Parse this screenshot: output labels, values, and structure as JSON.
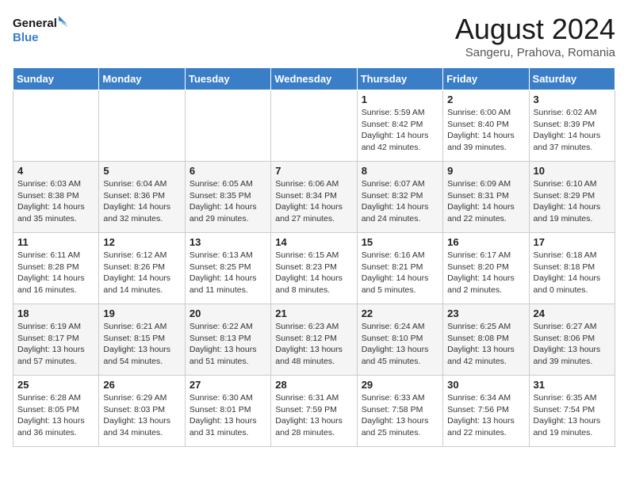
{
  "header": {
    "logo_line1": "General",
    "logo_line2": "Blue",
    "month_year": "August 2024",
    "location": "Sangeru, Prahova, Romania"
  },
  "weekdays": [
    "Sunday",
    "Monday",
    "Tuesday",
    "Wednesday",
    "Thursday",
    "Friday",
    "Saturday"
  ],
  "weeks": [
    [
      {
        "day": "",
        "info": ""
      },
      {
        "day": "",
        "info": ""
      },
      {
        "day": "",
        "info": ""
      },
      {
        "day": "",
        "info": ""
      },
      {
        "day": "1",
        "info": "Sunrise: 5:59 AM\nSunset: 8:42 PM\nDaylight: 14 hours\nand 42 minutes."
      },
      {
        "day": "2",
        "info": "Sunrise: 6:00 AM\nSunset: 8:40 PM\nDaylight: 14 hours\nand 39 minutes."
      },
      {
        "day": "3",
        "info": "Sunrise: 6:02 AM\nSunset: 8:39 PM\nDaylight: 14 hours\nand 37 minutes."
      }
    ],
    [
      {
        "day": "4",
        "info": "Sunrise: 6:03 AM\nSunset: 8:38 PM\nDaylight: 14 hours\nand 35 minutes."
      },
      {
        "day": "5",
        "info": "Sunrise: 6:04 AM\nSunset: 8:36 PM\nDaylight: 14 hours\nand 32 minutes."
      },
      {
        "day": "6",
        "info": "Sunrise: 6:05 AM\nSunset: 8:35 PM\nDaylight: 14 hours\nand 29 minutes."
      },
      {
        "day": "7",
        "info": "Sunrise: 6:06 AM\nSunset: 8:34 PM\nDaylight: 14 hours\nand 27 minutes."
      },
      {
        "day": "8",
        "info": "Sunrise: 6:07 AM\nSunset: 8:32 PM\nDaylight: 14 hours\nand 24 minutes."
      },
      {
        "day": "9",
        "info": "Sunrise: 6:09 AM\nSunset: 8:31 PM\nDaylight: 14 hours\nand 22 minutes."
      },
      {
        "day": "10",
        "info": "Sunrise: 6:10 AM\nSunset: 8:29 PM\nDaylight: 14 hours\nand 19 minutes."
      }
    ],
    [
      {
        "day": "11",
        "info": "Sunrise: 6:11 AM\nSunset: 8:28 PM\nDaylight: 14 hours\nand 16 minutes."
      },
      {
        "day": "12",
        "info": "Sunrise: 6:12 AM\nSunset: 8:26 PM\nDaylight: 14 hours\nand 14 minutes."
      },
      {
        "day": "13",
        "info": "Sunrise: 6:13 AM\nSunset: 8:25 PM\nDaylight: 14 hours\nand 11 minutes."
      },
      {
        "day": "14",
        "info": "Sunrise: 6:15 AM\nSunset: 8:23 PM\nDaylight: 14 hours\nand 8 minutes."
      },
      {
        "day": "15",
        "info": "Sunrise: 6:16 AM\nSunset: 8:21 PM\nDaylight: 14 hours\nand 5 minutes."
      },
      {
        "day": "16",
        "info": "Sunrise: 6:17 AM\nSunset: 8:20 PM\nDaylight: 14 hours\nand 2 minutes."
      },
      {
        "day": "17",
        "info": "Sunrise: 6:18 AM\nSunset: 8:18 PM\nDaylight: 14 hours\nand 0 minutes."
      }
    ],
    [
      {
        "day": "18",
        "info": "Sunrise: 6:19 AM\nSunset: 8:17 PM\nDaylight: 13 hours\nand 57 minutes."
      },
      {
        "day": "19",
        "info": "Sunrise: 6:21 AM\nSunset: 8:15 PM\nDaylight: 13 hours\nand 54 minutes."
      },
      {
        "day": "20",
        "info": "Sunrise: 6:22 AM\nSunset: 8:13 PM\nDaylight: 13 hours\nand 51 minutes."
      },
      {
        "day": "21",
        "info": "Sunrise: 6:23 AM\nSunset: 8:12 PM\nDaylight: 13 hours\nand 48 minutes."
      },
      {
        "day": "22",
        "info": "Sunrise: 6:24 AM\nSunset: 8:10 PM\nDaylight: 13 hours\nand 45 minutes."
      },
      {
        "day": "23",
        "info": "Sunrise: 6:25 AM\nSunset: 8:08 PM\nDaylight: 13 hours\nand 42 minutes."
      },
      {
        "day": "24",
        "info": "Sunrise: 6:27 AM\nSunset: 8:06 PM\nDaylight: 13 hours\nand 39 minutes."
      }
    ],
    [
      {
        "day": "25",
        "info": "Sunrise: 6:28 AM\nSunset: 8:05 PM\nDaylight: 13 hours\nand 36 minutes."
      },
      {
        "day": "26",
        "info": "Sunrise: 6:29 AM\nSunset: 8:03 PM\nDaylight: 13 hours\nand 34 minutes."
      },
      {
        "day": "27",
        "info": "Sunrise: 6:30 AM\nSunset: 8:01 PM\nDaylight: 13 hours\nand 31 minutes."
      },
      {
        "day": "28",
        "info": "Sunrise: 6:31 AM\nSunset: 7:59 PM\nDaylight: 13 hours\nand 28 minutes."
      },
      {
        "day": "29",
        "info": "Sunrise: 6:33 AM\nSunset: 7:58 PM\nDaylight: 13 hours\nand 25 minutes."
      },
      {
        "day": "30",
        "info": "Sunrise: 6:34 AM\nSunset: 7:56 PM\nDaylight: 13 hours\nand 22 minutes."
      },
      {
        "day": "31",
        "info": "Sunrise: 6:35 AM\nSunset: 7:54 PM\nDaylight: 13 hours\nand 19 minutes."
      }
    ]
  ]
}
